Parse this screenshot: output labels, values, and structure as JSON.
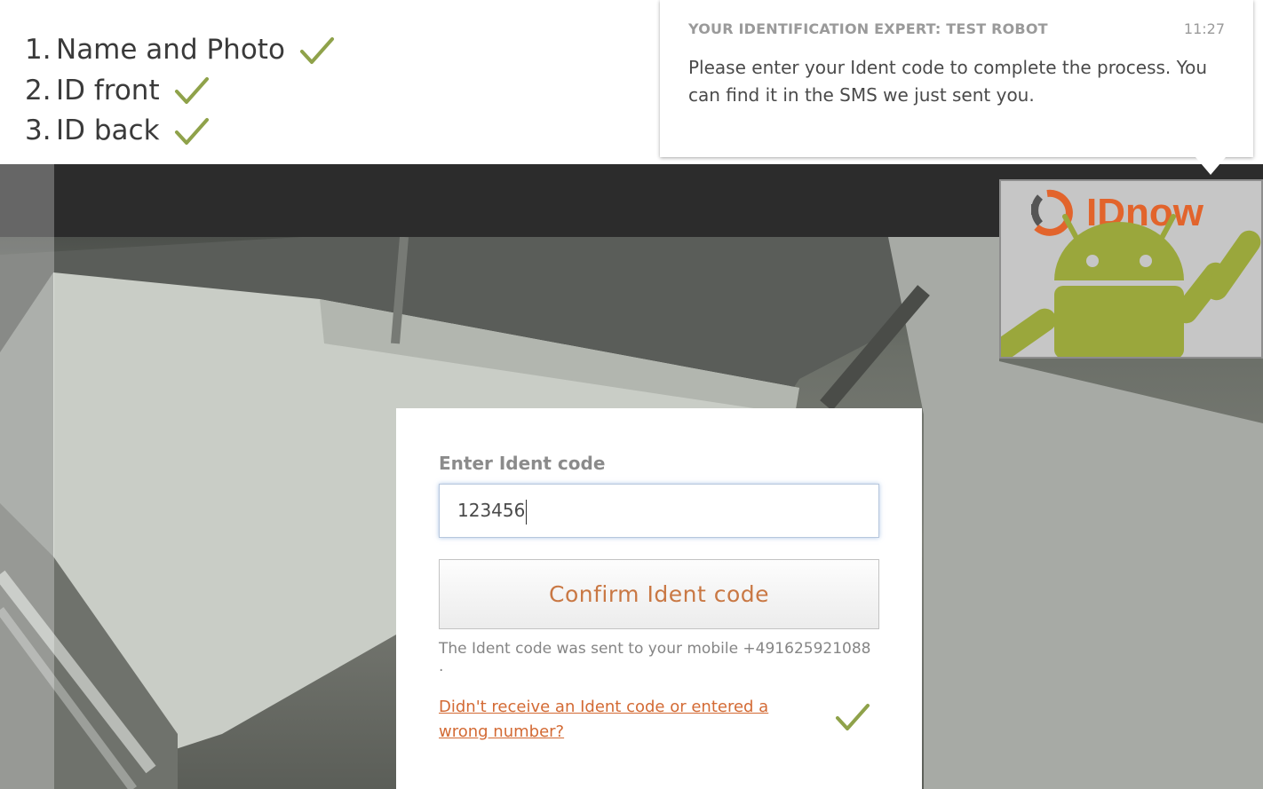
{
  "steps": [
    {
      "num": "1.",
      "label": "Name and Photo"
    },
    {
      "num": "2.",
      "label": "ID front"
    },
    {
      "num": "3.",
      "label": "ID back"
    }
  ],
  "expert": {
    "title": "YOUR IDENTIFICATION EXPERT: TEST ROBOT",
    "time": "11:27",
    "message": "Please enter your Ident code to complete the process. You can find it in the SMS we just sent you."
  },
  "selfview": {
    "logo_text": "IDnow"
  },
  "ident": {
    "label": "Enter Ident code",
    "value": "123456",
    "confirm_label": "Confirm Ident code",
    "sent_info": "The Ident code was sent to your mobile +491625921088 .",
    "resend_link": "Didn't receive an Ident code or entered a wrong number?"
  },
  "colors": {
    "check": "#8fa24a",
    "accent": "#d36a34",
    "android": "#9aa73c"
  },
  "icons": [
    "checkmark-icon",
    "android-robot-icon",
    "idnow-logo"
  ]
}
